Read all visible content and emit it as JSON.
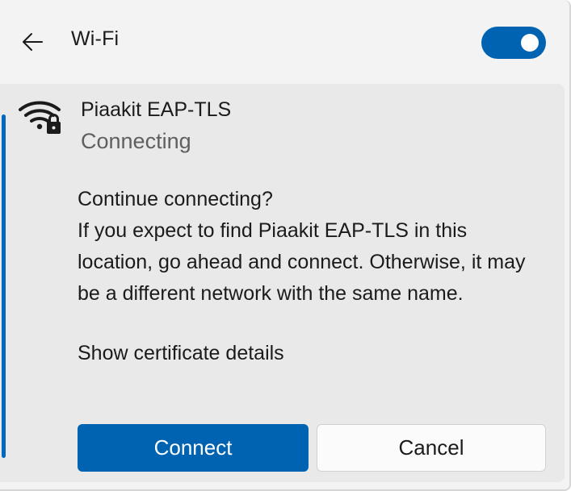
{
  "header": {
    "back_icon": "arrow-left-icon",
    "title": "Wi-Fi",
    "toggle_on": true,
    "accent_color": "#0063b1"
  },
  "network": {
    "icon": "wifi-secured-icon",
    "name": "Piaakit EAP-TLS",
    "status": "Connecting"
  },
  "message": {
    "heading": "Continue connecting?",
    "body": "If you expect to find Piaakit EAP-TLS in this location, go ahead and connect. Otherwise, it may be a different network with the same name.",
    "certificate_link": "Show certificate details"
  },
  "buttons": {
    "connect": "Connect",
    "cancel": "Cancel"
  }
}
